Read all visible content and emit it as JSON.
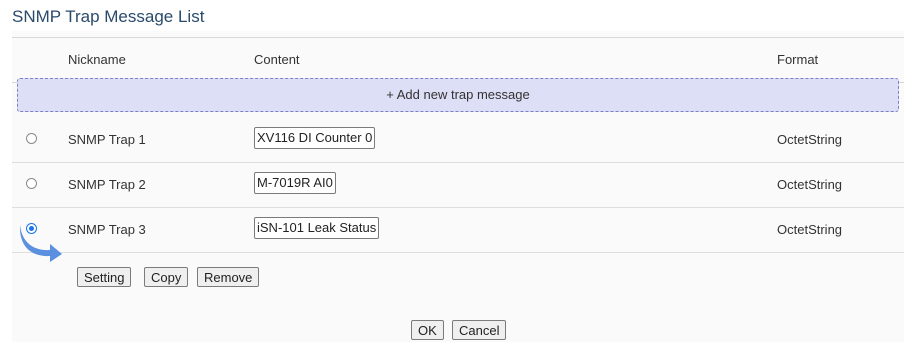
{
  "page": {
    "title": "SNMP Trap Message List"
  },
  "table": {
    "columns": {
      "nickname": "Nickname",
      "content": "Content",
      "format": "Format"
    },
    "add_label": "+ Add new trap message",
    "rows": [
      {
        "nickname": "SNMP Trap 1",
        "content": "XV116 DI Counter 0",
        "format": "OctetString",
        "selected": false
      },
      {
        "nickname": "SNMP Trap 2",
        "content": "M-7019R AI0",
        "format": "OctetString",
        "selected": false
      },
      {
        "nickname": "SNMP Trap 3",
        "content": "iSN-101 Leak Status",
        "format": "OctetString",
        "selected": true
      }
    ]
  },
  "actions": {
    "setting": "Setting",
    "copy": "Copy",
    "remove": "Remove"
  },
  "footer": {
    "ok": "OK",
    "cancel": "Cancel"
  },
  "colors": {
    "accent": "#1a73e8",
    "add_bg": "#dcdff5",
    "add_border": "#7d7fc8",
    "arrow": "#5b8fe0"
  }
}
